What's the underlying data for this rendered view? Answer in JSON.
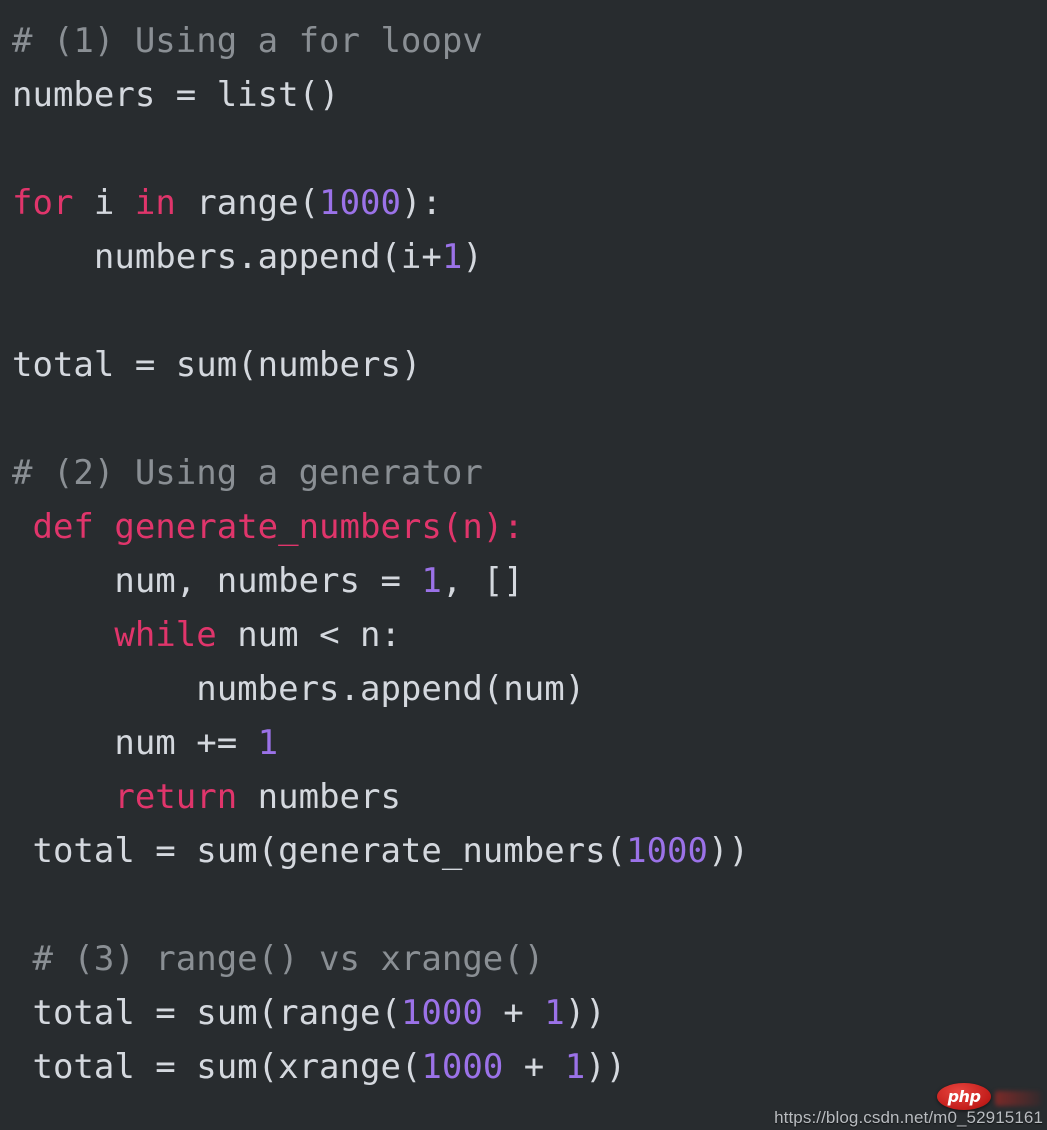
{
  "editor": {
    "background_color": "#282c2f",
    "foreground_color": "#d4d8de",
    "comment_color": "#8a8f94",
    "keyword_color": "#e0356b",
    "number_color": "#9b72e8",
    "language": "python",
    "lines": [
      {
        "id": "line-1",
        "indent": 0,
        "text": "# (1) Using a for loopv",
        "tokens": [
          {
            "t": "# (1) Using a for loopv",
            "c": "comment"
          }
        ]
      },
      {
        "id": "line-2",
        "indent": 0,
        "text": "numbers = list()",
        "tokens": [
          {
            "t": "numbers = list()",
            "c": "plain"
          }
        ]
      },
      {
        "id": "line-3",
        "indent": 0,
        "text": "",
        "tokens": []
      },
      {
        "id": "line-4",
        "indent": 0,
        "text": "for i in range(1000):",
        "tokens": [
          {
            "t": "for",
            "c": "kw"
          },
          {
            "t": " i ",
            "c": "plain"
          },
          {
            "t": "in",
            "c": "kw"
          },
          {
            "t": " range(",
            "c": "plain"
          },
          {
            "t": "1000",
            "c": "num"
          },
          {
            "t": "):",
            "c": "plain"
          }
        ]
      },
      {
        "id": "line-5",
        "indent": 0,
        "text": "    numbers.append(i+1)",
        "tokens": [
          {
            "t": "    numbers.append(i+",
            "c": "plain"
          },
          {
            "t": "1",
            "c": "num"
          },
          {
            "t": ")",
            "c": "plain"
          }
        ]
      },
      {
        "id": "line-6",
        "indent": 0,
        "text": "",
        "tokens": []
      },
      {
        "id": "line-7",
        "indent": 0,
        "text": "total = sum(numbers)",
        "tokens": [
          {
            "t": "total = sum(numbers)",
            "c": "plain"
          }
        ]
      },
      {
        "id": "line-8",
        "indent": 0,
        "text": "",
        "tokens": []
      },
      {
        "id": "line-9",
        "indent": 0,
        "text": "# (2) Using a generator",
        "tokens": [
          {
            "t": "# (2) Using a generator",
            "c": "comment"
          }
        ]
      },
      {
        "id": "line-10",
        "indent": 0,
        "text": " def generate_numbers(n):",
        "tokens": [
          {
            "t": " def generate_numbers(n):",
            "c": "kw"
          }
        ]
      },
      {
        "id": "line-11",
        "indent": 0,
        "text": "     num, numbers = 1, []",
        "tokens": [
          {
            "t": "     num, numbers = ",
            "c": "plain"
          },
          {
            "t": "1",
            "c": "num"
          },
          {
            "t": ", []",
            "c": "plain"
          }
        ]
      },
      {
        "id": "line-12",
        "indent": 0,
        "text": "     while num < n:",
        "tokens": [
          {
            "t": "     ",
            "c": "plain"
          },
          {
            "t": "while",
            "c": "kw"
          },
          {
            "t": " num < n:",
            "c": "plain"
          }
        ]
      },
      {
        "id": "line-13",
        "indent": 0,
        "text": "         numbers.append(num)",
        "tokens": [
          {
            "t": "         numbers.append(num)",
            "c": "plain"
          }
        ]
      },
      {
        "id": "line-14",
        "indent": 0,
        "text": "     num += 1",
        "tokens": [
          {
            "t": "     num += ",
            "c": "plain"
          },
          {
            "t": "1",
            "c": "num"
          }
        ]
      },
      {
        "id": "line-15",
        "indent": 0,
        "text": "     return numbers",
        "tokens": [
          {
            "t": "     ",
            "c": "plain"
          },
          {
            "t": "return",
            "c": "kw"
          },
          {
            "t": " numbers",
            "c": "plain"
          }
        ]
      },
      {
        "id": "line-16",
        "indent": 0,
        "text": " total = sum(generate_numbers(1000))",
        "tokens": [
          {
            "t": " total = sum(generate_numbers(",
            "c": "plain"
          },
          {
            "t": "1000",
            "c": "num"
          },
          {
            "t": "))",
            "c": "plain"
          }
        ]
      },
      {
        "id": "line-17",
        "indent": 0,
        "text": "",
        "tokens": []
      },
      {
        "id": "line-18",
        "indent": 0,
        "text": " # (3) range() vs xrange()",
        "tokens": [
          {
            "t": " # (3) range() vs xrange()",
            "c": "comment"
          }
        ]
      },
      {
        "id": "line-19",
        "indent": 0,
        "text": " total = sum(range(1000 + 1))",
        "tokens": [
          {
            "t": " total = sum(range(",
            "c": "plain"
          },
          {
            "t": "1000",
            "c": "num"
          },
          {
            "t": " + ",
            "c": "plain"
          },
          {
            "t": "1",
            "c": "num"
          },
          {
            "t": "))",
            "c": "plain"
          }
        ]
      },
      {
        "id": "line-20",
        "indent": 0,
        "text": " total = sum(xrange(1000 + 1))",
        "tokens": [
          {
            "t": " total = sum(xrange(",
            "c": "plain"
          },
          {
            "t": "1000",
            "c": "num"
          },
          {
            "t": " + ",
            "c": "plain"
          },
          {
            "t": "1",
            "c": "num"
          },
          {
            "t": "))",
            "c": "plain"
          }
        ]
      }
    ]
  },
  "watermark": {
    "url_text": "https://blog.csdn.net/m0_52915161",
    "badge_text": "php",
    "badge_color": "#c21d1a"
  }
}
